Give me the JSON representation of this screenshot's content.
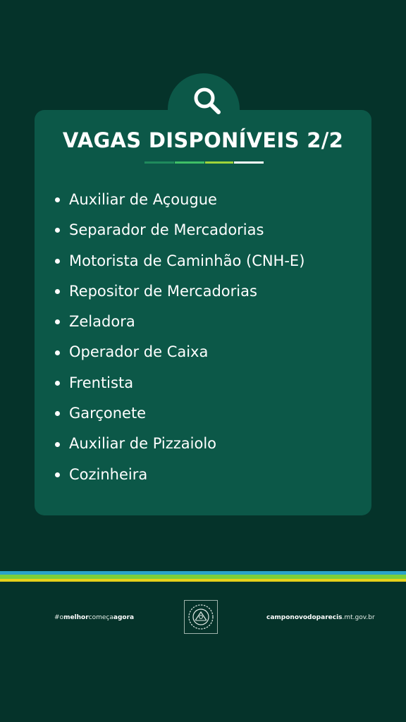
{
  "title": "VAGAS DISPONÍVEIS 2/2",
  "jobs": [
    "Auxiliar de Açougue",
    "Separador de Mercadorias",
    "Motorista de Caminhão (CNH-E)",
    "Repositor de Mercadorias",
    "Zeladora",
    "Operador de Caixa",
    "Frentista",
    "Garçonete",
    "Auxiliar de Pizzaiolo",
    "Cozinheira"
  ],
  "footer": {
    "hashtag": {
      "hash": "#",
      "p1": "o",
      "p2": "melhor",
      "p3": "começa",
      "p4": "agora"
    },
    "site": {
      "bold": "camponovodoparecis",
      "rest": ".mt.gov.br"
    }
  },
  "colors": {
    "background": "#05332a",
    "card": "#0c5848",
    "stripe_blue": "#2ba3c9",
    "stripe_green": "#7ccf3a",
    "stripe_yellow": "#e7d21a"
  },
  "icons": {
    "header": "search-icon",
    "footer": "municipal-seal-icon"
  }
}
